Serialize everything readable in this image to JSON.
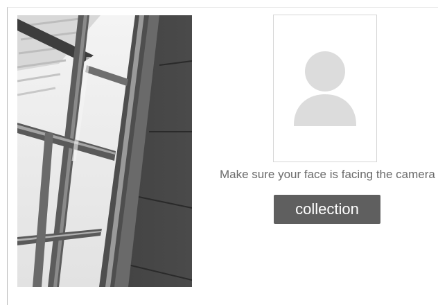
{
  "camera": {
    "preview_content": "grayscale view of a ceiling window frame and wall panels"
  },
  "avatar": {
    "icon": "user-silhouette-icon"
  },
  "instruction_text": "Make sure your face is facing the camera",
  "collection_button_label": "collection",
  "colors": {
    "button_bg": "#5f5f5f",
    "button_text": "#ffffff",
    "instruction_text": "#6a6a6a",
    "avatar_placeholder": "#dcdcdc",
    "avatar_border": "#d6d6d6"
  }
}
